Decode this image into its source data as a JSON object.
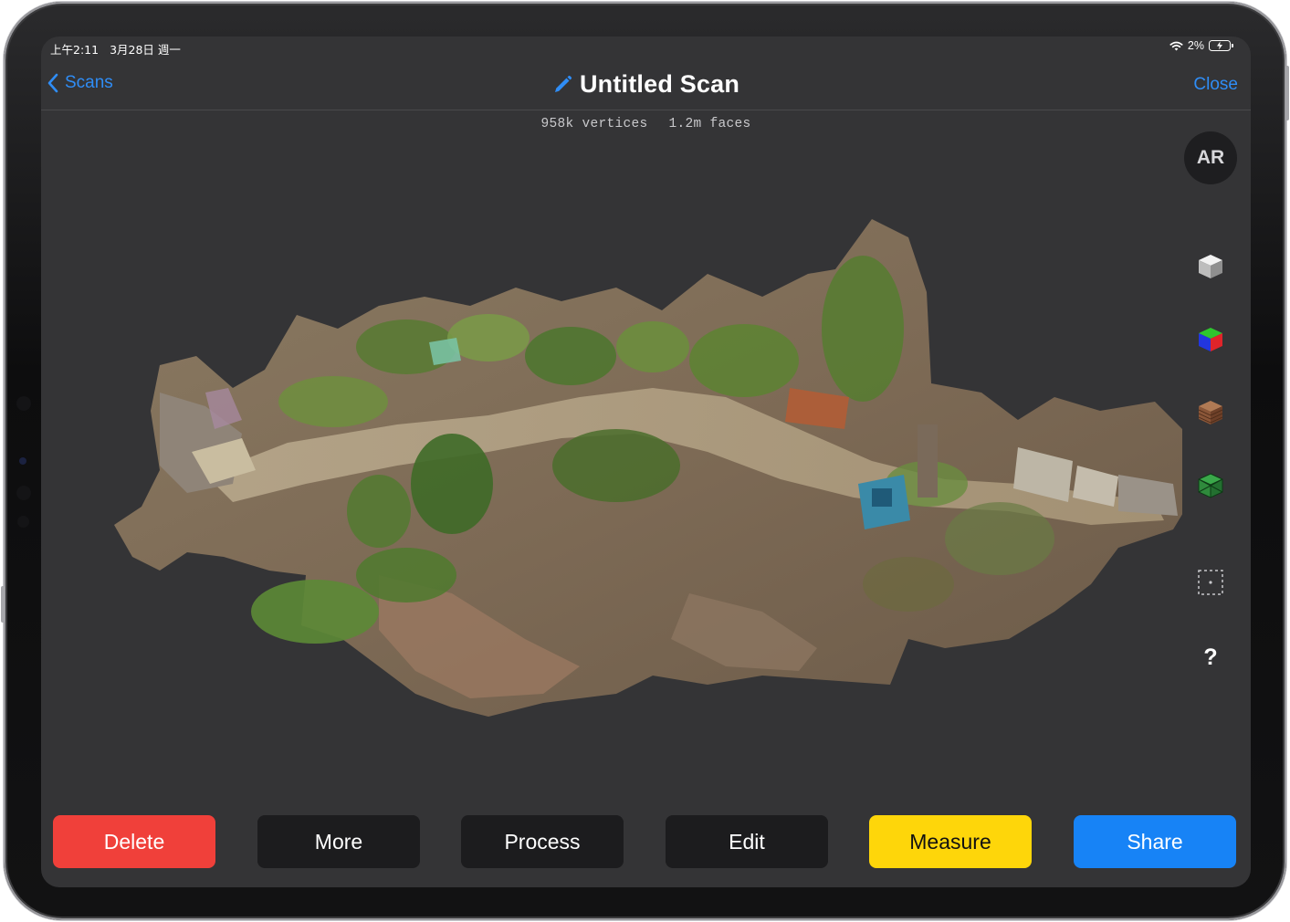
{
  "status_bar": {
    "time": "上午2:11",
    "date": "3月28日 週一",
    "battery_percent": "2%",
    "wifi_icon": "wifi-icon",
    "battery_icon": "battery-charging-icon"
  },
  "nav": {
    "back_label": "Scans",
    "title": "Untitled Scan",
    "close_label": "Close",
    "edit_icon": "pencil-icon"
  },
  "stats": {
    "vertices": "958k vertices",
    "faces": "1.2m faces"
  },
  "tools": {
    "ar_label": "AR",
    "items": [
      "solid-cube-icon",
      "rgb-cube-icon",
      "textured-cube-icon",
      "wireframe-cube-icon",
      "bounding-box-icon"
    ],
    "help_label": "?"
  },
  "actions": [
    {
      "label": "Delete",
      "color": "#f0403a"
    },
    {
      "label": "More",
      "color": "#1c1c1e"
    },
    {
      "label": "Process",
      "color": "#1c1c1e"
    },
    {
      "label": "Edit",
      "color": "#1c1c1e"
    },
    {
      "label": "Measure",
      "color": "#fed60a"
    },
    {
      "label": "Share",
      "color": "#1783f6"
    }
  ],
  "colors": {
    "accent": "#2f8df6",
    "screen_bg": "#343436"
  }
}
